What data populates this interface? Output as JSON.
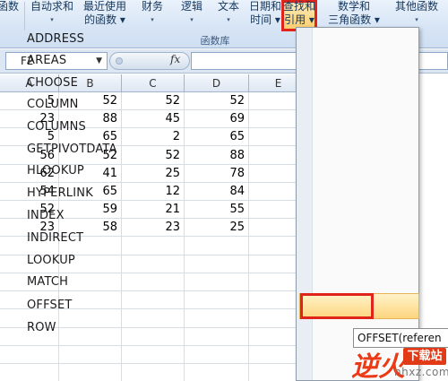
{
  "ribbon": {
    "buttons": [
      {
        "line1": "函数",
        "line2": ""
      },
      {
        "line1": "自动求和",
        "line2": "▾"
      },
      {
        "line1": "最近使用",
        "line2": "的函数 ▾"
      },
      {
        "line1": "财务",
        "line2": "▾"
      },
      {
        "line1": "逻辑",
        "line2": "▾"
      },
      {
        "line1": "文本",
        "line2": "▾"
      },
      {
        "line1": "日期和",
        "line2": "时间 ▾"
      },
      {
        "line1": "查找和",
        "line2": "引用 ▾"
      },
      {
        "line1": "数学和",
        "line2": "三角函数 ▾"
      },
      {
        "line1": "其他函数",
        "line2": "▾"
      }
    ],
    "group_label": "函数库"
  },
  "formula_bar": {
    "name_box": "F2",
    "fx": "fx",
    "value": ""
  },
  "grid": {
    "columns": [
      "A",
      "B",
      "C",
      "D",
      "E"
    ],
    "rows": [
      [
        "5",
        "52",
        "52",
        "52",
        ""
      ],
      [
        "23",
        "88",
        "45",
        "69",
        ""
      ],
      [
        "5",
        "65",
        "2",
        "65",
        ""
      ],
      [
        "56",
        "52",
        "52",
        "88",
        ""
      ],
      [
        "62",
        "41",
        "25",
        "78",
        ""
      ],
      [
        "54",
        "65",
        "12",
        "84",
        ""
      ],
      [
        "52",
        "59",
        "21",
        "55",
        ""
      ],
      [
        "23",
        "58",
        "23",
        "25",
        ""
      ]
    ]
  },
  "menu": {
    "items": [
      "ADDRESS",
      "AREAS",
      "CHOOSE",
      "COLUMN",
      "COLUMNS",
      "GETPIVOTDATA",
      "HLOOKUP",
      "HYPERLINK",
      "INDEX",
      "INDIRECT",
      "LOOKUP",
      "MATCH",
      "OFFSET",
      "ROW"
    ],
    "highlighted": "OFFSET"
  },
  "tooltip": {
    "text": "OFFSET(referen"
  },
  "watermark": {
    "logo": "逆火",
    "badge": "下载站",
    "url": "nhxz.com"
  },
  "colors": {
    "highlight_box": "#e0241b",
    "menu_highlight": "#fcd57e",
    "ribbon_text": "#15375d"
  }
}
